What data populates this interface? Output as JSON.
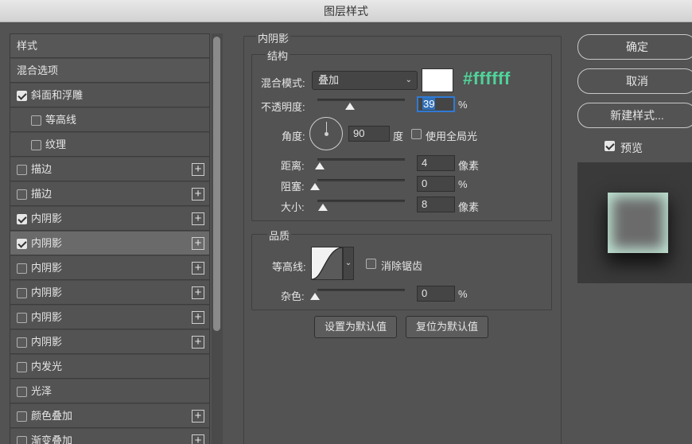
{
  "window": {
    "title": "图层样式"
  },
  "style_list": {
    "items": [
      {
        "label": "样式",
        "checkbox": null,
        "plus": false,
        "indent": 0,
        "selected": false,
        "header": true
      },
      {
        "label": "混合选项",
        "checkbox": null,
        "plus": false,
        "indent": 0,
        "selected": false,
        "header": true
      },
      {
        "label": "斜面和浮雕",
        "checkbox": true,
        "plus": false,
        "indent": 0,
        "selected": false
      },
      {
        "label": "等高线",
        "checkbox": false,
        "plus": false,
        "indent": 1,
        "selected": false
      },
      {
        "label": "纹理",
        "checkbox": false,
        "plus": false,
        "indent": 1,
        "selected": false
      },
      {
        "label": "描边",
        "checkbox": false,
        "plus": true,
        "indent": 0,
        "selected": false
      },
      {
        "label": "描边",
        "checkbox": false,
        "plus": true,
        "indent": 0,
        "selected": false
      },
      {
        "label": "内阴影",
        "checkbox": true,
        "plus": true,
        "indent": 0,
        "selected": false
      },
      {
        "label": "内阴影",
        "checkbox": true,
        "plus": true,
        "indent": 0,
        "selected": true
      },
      {
        "label": "内阴影",
        "checkbox": false,
        "plus": true,
        "indent": 0,
        "selected": false
      },
      {
        "label": "内阴影",
        "checkbox": false,
        "plus": true,
        "indent": 0,
        "selected": false
      },
      {
        "label": "内阴影",
        "checkbox": false,
        "plus": true,
        "indent": 0,
        "selected": false
      },
      {
        "label": "内阴影",
        "checkbox": false,
        "plus": true,
        "indent": 0,
        "selected": false
      },
      {
        "label": "内发光",
        "checkbox": false,
        "plus": false,
        "indent": 0,
        "selected": false
      },
      {
        "label": "光泽",
        "checkbox": false,
        "plus": false,
        "indent": 0,
        "selected": false
      },
      {
        "label": "颜色叠加",
        "checkbox": false,
        "plus": true,
        "indent": 0,
        "selected": false
      },
      {
        "label": "渐变叠加",
        "checkbox": false,
        "plus": true,
        "indent": 0,
        "selected": false
      }
    ]
  },
  "panel": {
    "title": "内阴影",
    "structure": {
      "title": "结构",
      "blend_mode_label": "混合模式:",
      "blend_mode_value": "叠加",
      "color_hex": "#ffffff",
      "opacity_label": "不透明度:",
      "opacity_value": "39",
      "opacity_unit": "%",
      "angle_label": "角度:",
      "angle_value": "90",
      "angle_unit": "度",
      "global_light_label": "使用全局光",
      "global_light_checked": false,
      "distance_label": "距离:",
      "distance_value": "4",
      "distance_unit": "像素",
      "choke_label": "阻塞:",
      "choke_value": "0",
      "choke_unit": "%",
      "size_label": "大小:",
      "size_value": "8",
      "size_unit": "像素"
    },
    "quality": {
      "title": "品质",
      "contour_label": "等高线:",
      "anti_alias_label": "消除锯齿",
      "anti_alias_checked": false,
      "noise_label": "杂色:",
      "noise_value": "0",
      "noise_unit": "%"
    },
    "buttons": {
      "make_default": "设置为默认值",
      "reset_default": "复位为默认值"
    }
  },
  "actions": {
    "ok": "确定",
    "cancel": "取消",
    "new_style": "新建样式...",
    "preview_label": "预览",
    "preview_checked": true
  },
  "colors": {
    "hex_annotation": "#4fd39a",
    "swatch": "#ffffff",
    "selection": "#2f7ad6"
  }
}
